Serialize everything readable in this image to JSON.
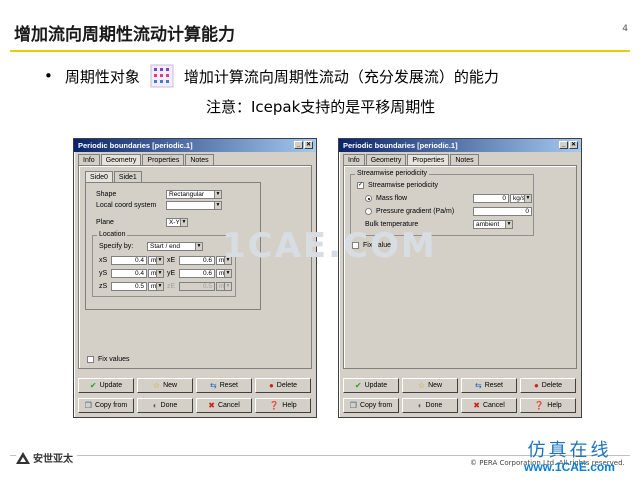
{
  "slide": {
    "title": "增加流向周期性流动计算能力",
    "page_number": "4",
    "bullet_prefix": "周期性对象",
    "bullet_suffix": "增加计算流向周期性流动（充分发展流）的能力",
    "note": "注意：Icepak支持的是平移周期性",
    "watermark": "1CAE.COM"
  },
  "left_dialog": {
    "title": "Periodic boundaries [periodic.1]",
    "tabs": [
      "Info",
      "Geometry",
      "Properties",
      "Notes"
    ],
    "active_tab": "Geometry",
    "subtabs": [
      "Side0",
      "Side1"
    ],
    "shape_label": "Shape",
    "shape_value": "Rectangular",
    "local_coord_label": "Local coord system",
    "local_coord_value": "",
    "plane_label": "Plane",
    "plane_value": "X-Y",
    "location_label": "Location",
    "specify_label": "Specify by:",
    "specify_value": "Start / end",
    "coords": [
      {
        "label": "xS",
        "value": "0.4",
        "unit": "m",
        "label2": "xE",
        "value2": "0.6",
        "unit2": "m"
      },
      {
        "label": "yS",
        "value": "0.4",
        "unit": "m",
        "label2": "yE",
        "value2": "0.6",
        "unit2": "m"
      },
      {
        "label": "zS",
        "value": "0.5",
        "unit": "m",
        "label2": "zE",
        "value2": "0.5",
        "unit2": "m"
      }
    ],
    "fix_values": "Fix values",
    "buttons": {
      "update": "Update",
      "new": "New",
      "reset": "Reset",
      "delete": "Delete",
      "copy_from": "Copy from",
      "done": "Done",
      "cancel": "Cancel",
      "help": "Help"
    }
  },
  "right_dialog": {
    "title": "Periodic boundaries [periodic.1]",
    "tabs": [
      "Info",
      "Geometry",
      "Properties",
      "Notes"
    ],
    "active_tab": "Properties",
    "group_title": "Streamwise periodicity",
    "streamwise_check": "Streamwise periodicity",
    "mass_flow_label": "Mass flow",
    "mass_flow_value": "0",
    "mass_flow_unit": "kg/s",
    "pressure_label": "Pressure gradient (Pa/m)",
    "pressure_value": "0",
    "bulk_label": "Bulk temperature",
    "bulk_value": "ambient",
    "fix_values": "Fix values",
    "buttons": {
      "update": "Update",
      "new": "New",
      "reset": "Reset",
      "delete": "Delete",
      "copy_from": "Copy from",
      "done": "Done",
      "cancel": "Cancel",
      "help": "Help"
    }
  },
  "footer": {
    "logo_text": "安世亚太",
    "copyright": "© PERA Corporation Ltd. All rights reserved.",
    "brand_cn": "仿真在线",
    "brand_url": "www.1CAE.com"
  },
  "colors": {
    "title_line": "#e8d000",
    "titlebar_start": "#0a246a",
    "brand_blue": "#1e73be"
  }
}
